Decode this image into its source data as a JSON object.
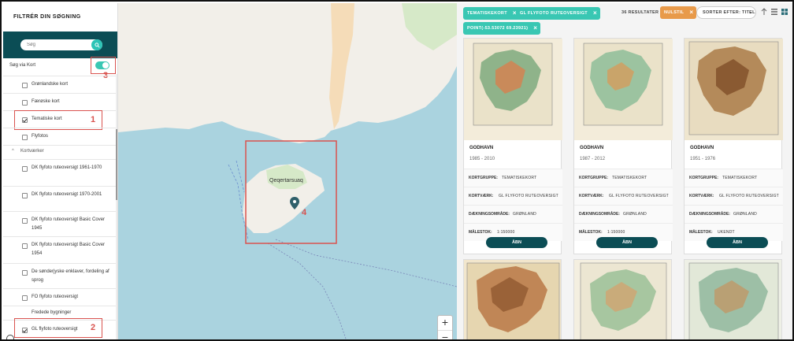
{
  "sidebar": {
    "title": "FILTRÉR DIN SØGNING",
    "search_placeholder": "Søg",
    "toggle_label": "Søg via Kort",
    "items": [
      {
        "label": "Grønlandske kort",
        "checked": false
      },
      {
        "label": "Færøske kort",
        "checked": false
      },
      {
        "label": "Tematiske kort",
        "checked": true
      },
      {
        "label": "Flyfotos",
        "checked": false
      }
    ],
    "section": "Kortværker",
    "subitems": [
      {
        "label": "DK flyfoto ruteoversigt 1961-1970",
        "checked": false
      },
      {
        "label": "DK flyfoto ruteoversigt 1970-2001",
        "checked": false
      },
      {
        "label": "DK flyfoto ruteoversigt Basic Cover 1945",
        "checked": false
      },
      {
        "label": "DK flyfoto ruteoversigt Basic Cover 1954",
        "checked": false
      },
      {
        "label": "De sønderjyske enklaver, fordeling af sprog",
        "checked": false
      },
      {
        "label": "FO flyfoto ruteoversigt",
        "checked": false
      },
      {
        "label": "Fredede bygninger",
        "checked": false
      },
      {
        "label": "GL flyfoto ruteoversigt",
        "checked": true
      }
    ],
    "annotations": [
      "1",
      "2",
      "3"
    ]
  },
  "map": {
    "place_label": "Qeqertarsuaq",
    "annotation": "4",
    "zoom_in": "+",
    "zoom_out": "−"
  },
  "results": {
    "chips": [
      "TEMATISKEKORT",
      "GL FLYFOTO RUTEOVERSIGT",
      "POINT(-53.53072 69.23921)"
    ],
    "count_text": "36 RESULTATER",
    "reset_label": "NULSTIL",
    "sort_label": "SORTER EFTER: TITEL",
    "cards": [
      {
        "title": "GODHAVN",
        "years": "1985 - 2010",
        "kortgruppe": "TEMATISKEKORT",
        "kortvaerk": "GL FLYFOTO RUTEOVERSIGT",
        "daekning": "GRØNLAND",
        "malestok": "1:150000",
        "open": "ÅBN"
      },
      {
        "title": "GODHAVN",
        "years": "1987 - 2012",
        "kortgruppe": "TEMATISKEKORT",
        "kortvaerk": "GL FLYFOTO RUTEOVERSIGT",
        "daekning": "GRØNLAND",
        "malestok": "1:150000",
        "open": "ÅBN"
      },
      {
        "title": "GODHAVN",
        "years": "1951 - 1976",
        "kortgruppe": "TEMATISKEKORT",
        "kortvaerk": "GL FLYFOTO RUTEOVERSIGT",
        "daekning": "GRØNLAND",
        "malestok": "UKENDT",
        "open": "ÅBN"
      }
    ],
    "labels": {
      "kortgruppe": "KORTGRUPPE:",
      "kortvaerk": "KORTVÆRK:",
      "daekning": "DÆKNINGSOMRÅDE:",
      "malestok": "MÅLESTOK:"
    }
  }
}
